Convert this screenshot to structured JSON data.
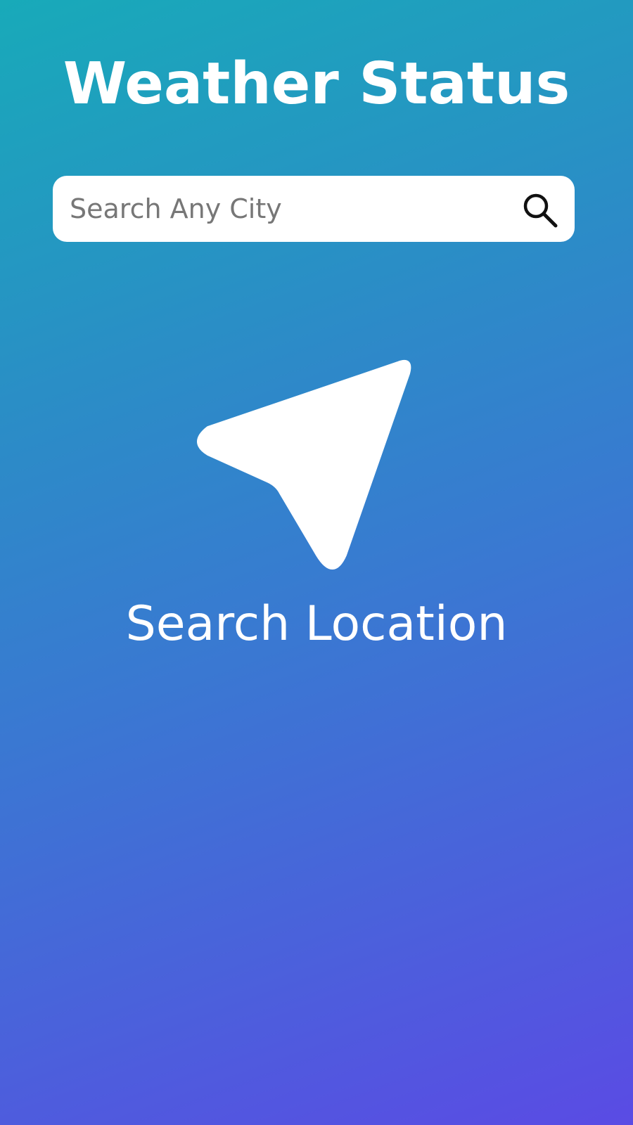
{
  "app": {
    "title": "Weather Status"
  },
  "search": {
    "placeholder": "Search Any City",
    "value": "",
    "icon": "search-icon"
  },
  "empty_state": {
    "icon": "navigation-arrow-icon",
    "label": "Search Location"
  },
  "colors": {
    "gradient_start": "#18aab9",
    "gradient_end": "#5a4be4",
    "text": "#ffffff",
    "search_bg": "#ffffff",
    "placeholder": "#777777"
  }
}
